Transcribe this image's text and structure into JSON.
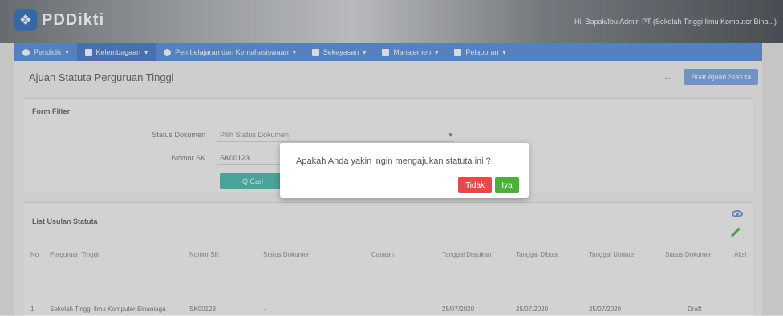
{
  "header": {
    "logo_text": "PDDikti",
    "user_text": "Hi, Bapak/Ibu Admin PT (Sekolah Tinggi Ilmu Komputer Bina...)"
  },
  "nav": {
    "items": [
      {
        "label": "Pendidik",
        "icon": "user-icon"
      },
      {
        "label": "Kelembagaan",
        "icon": "building-icon"
      },
      {
        "label": "Pembelajaran dan Kemahasiswaan",
        "icon": "user-icon"
      },
      {
        "label": "Sekayasan",
        "icon": "tag-icon"
      },
      {
        "label": "Manajemen",
        "icon": "building-icon"
      },
      {
        "label": "Pelaporan",
        "icon": "chart-icon"
      }
    ]
  },
  "page": {
    "title": "Ajuan Statuta Perguruan Tinggi",
    "new_button": "Buat Ajuan Statuta"
  },
  "filter": {
    "title": "Form Filter",
    "status_label": "Status Dokumen",
    "status_placeholder": "Pilih Status Dokumen",
    "sk_label": "Nomor SK",
    "sk_value": "SK00123",
    "search_button": "Q Cari"
  },
  "list": {
    "title": "List Usulan Statuta",
    "columns": [
      "No",
      "Perguruan Tinggi",
      "Nomor SK",
      "Status Dokumen",
      "Catatan",
      "Tanggal Diajukan",
      "Tanggal Dibuat",
      "Tanggal Update",
      "Status Dokumen",
      "Aksi"
    ],
    "rows": [
      {
        "no": "1",
        "pt": "Sekolah Tinggi Ilmu Komputer Binaniaga",
        "sk": "SK00123",
        "status": "-",
        "catatan": "",
        "diajukan": "25/07/2020",
        "dibuat": "25/07/2020",
        "update": "25/07/2020",
        "status2": "Draft"
      }
    ]
  },
  "modal": {
    "message": "Apakah Anda yakin ingin mengajukan statuta ini ?",
    "no_label": "Tidak",
    "yes_label": "Iya"
  },
  "colors": {
    "nav": "#5c8bd1",
    "no_button": "#e34b4b",
    "yes_button": "#4caf3c",
    "search_button": "#4fb1a6"
  }
}
